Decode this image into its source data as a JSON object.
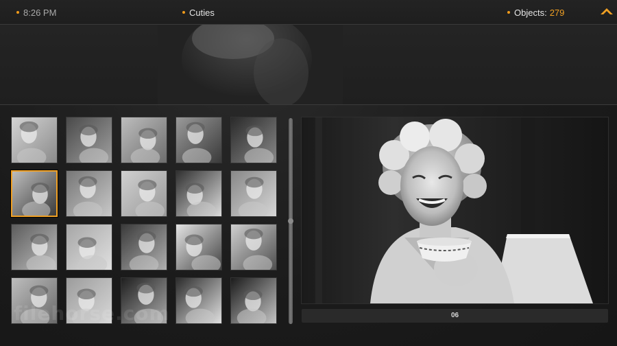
{
  "header": {
    "time": "8:26 PM",
    "album_title": "Cuties",
    "objects_label": "Objects:",
    "objects_count": "279"
  },
  "colors": {
    "accent": "#f0a024",
    "background": "#1c1c1c"
  },
  "icons": {
    "collapse": "chevron-up-icon"
  },
  "thumbnails": [
    {
      "name": "thumb-1",
      "selected": false
    },
    {
      "name": "thumb-2",
      "selected": false
    },
    {
      "name": "thumb-3",
      "selected": false
    },
    {
      "name": "thumb-4",
      "selected": false
    },
    {
      "name": "thumb-5",
      "selected": false
    },
    {
      "name": "thumb-6",
      "selected": true
    },
    {
      "name": "thumb-7",
      "selected": false
    },
    {
      "name": "thumb-8",
      "selected": false
    },
    {
      "name": "thumb-9",
      "selected": false
    },
    {
      "name": "thumb-10",
      "selected": false
    },
    {
      "name": "thumb-11",
      "selected": false
    },
    {
      "name": "thumb-12",
      "selected": false
    },
    {
      "name": "thumb-13",
      "selected": false
    },
    {
      "name": "thumb-14",
      "selected": false
    },
    {
      "name": "thumb-15",
      "selected": false
    },
    {
      "name": "thumb-16",
      "selected": false
    },
    {
      "name": "thumb-17",
      "selected": false
    },
    {
      "name": "thumb-18",
      "selected": false
    },
    {
      "name": "thumb-19",
      "selected": false
    },
    {
      "name": "thumb-20",
      "selected": false
    }
  ],
  "preview": {
    "caption": "06"
  },
  "watermark": "filehorse.com"
}
